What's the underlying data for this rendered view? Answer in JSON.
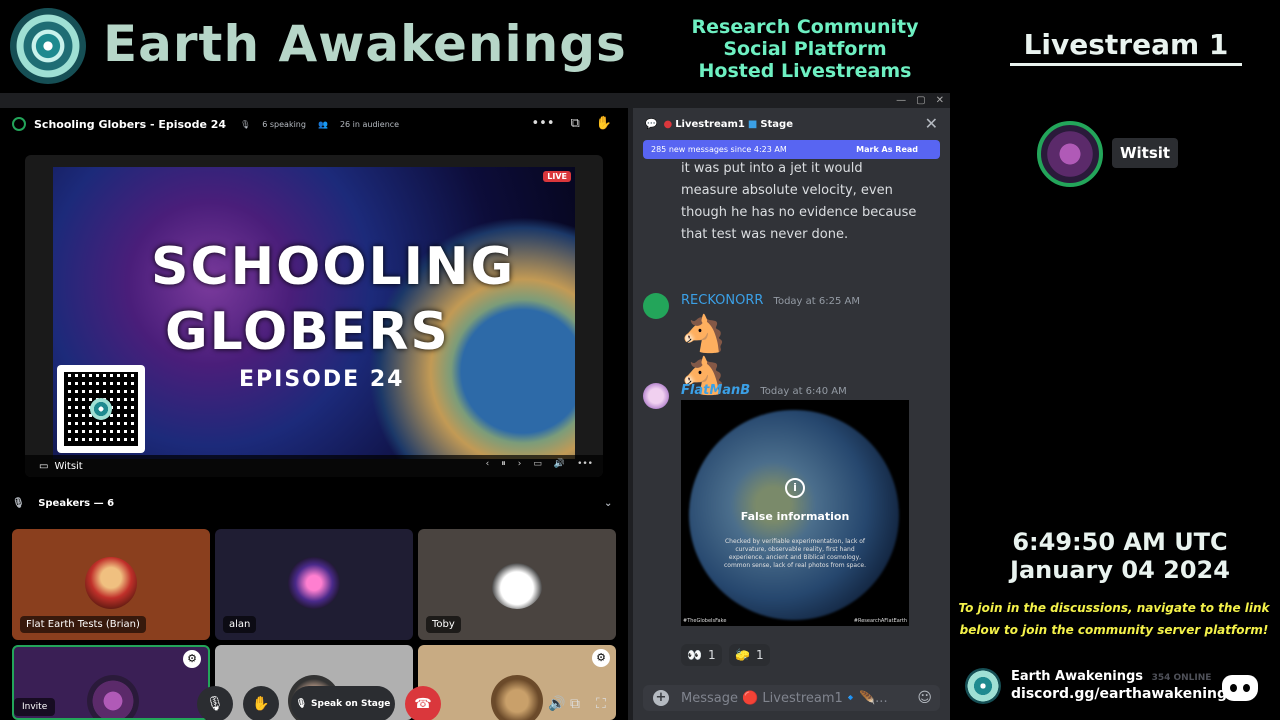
{
  "banner": {
    "brand": "Earth Awakenings",
    "tagline": [
      "Research Community",
      "Social Platform",
      "Hosted Livestreams"
    ],
    "stream_title": "Livestream 1"
  },
  "stage": {
    "title": "Schooling Globers - Episode 24",
    "speaking": "6 speaking",
    "audience": "26 in audience",
    "live_badge": "LIVE",
    "art_line1": "SCHOOLING",
    "art_line2": "GLOBERS",
    "art_line3": "EPISODE 24",
    "streamer": "Witsit",
    "speakers_header": "Speakers — 6",
    "tiles": [
      {
        "name": "Flat Earth Tests (Brian)",
        "bg": "#8a3f1e"
      },
      {
        "name": "alan",
        "bg": "#1f1d33"
      },
      {
        "name": "Toby",
        "bg": "#4a4440"
      },
      {
        "name": "Invite",
        "bg": "#3a1f55"
      },
      {
        "name": "",
        "bg": "#b0b0b0"
      },
      {
        "name": "",
        "bg": "#c8ab83"
      }
    ],
    "controls": {
      "speak_on_stage": "Speak on Stage"
    }
  },
  "chat": {
    "channel": "Livestream1",
    "channel_suffix": "Stage",
    "new_messages": "285 new messages since 4:23 AM",
    "mark_as_read": "Mark As Read",
    "continued_text": "it was put into a jet it would measure absolute velocity, even though he has no evidence because that test was never done.",
    "messages": [
      {
        "author": "RECKONORR",
        "time": "Today at 6:25 AM",
        "color": "#3ba0e6"
      },
      {
        "author": "FlatManB",
        "time": "Today at 6:40 AM",
        "color": "#3ba0e6"
      }
    ],
    "attachment": {
      "title": "False information",
      "desc": "Checked by verifiable experimentation, lack of curvature, observable reality, first hand experience, ancient and Biblical cosmology, common sense, lack of real photos from space.",
      "foot_left": "#TheGlobeIsFake",
      "foot_right": "#ResearchAFlatEarth"
    },
    "reactions": [
      {
        "emoji": "👀",
        "count": "1"
      },
      {
        "emoji": "🧽",
        "count": "1"
      }
    ],
    "placeholder": "Message 🔴 Livestream1🔹🪶..."
  },
  "right": {
    "user": "Witsit",
    "time": "6:49:50 AM UTC",
    "date": "January 04 2024",
    "join_text_1": "To join in the discussions, navigate to the link",
    "join_text_2": "below to join the community server platform!",
    "server_name": "Earth Awakenings",
    "online": "354 ONLINE",
    "link": "discord.gg/earthawakenings"
  }
}
